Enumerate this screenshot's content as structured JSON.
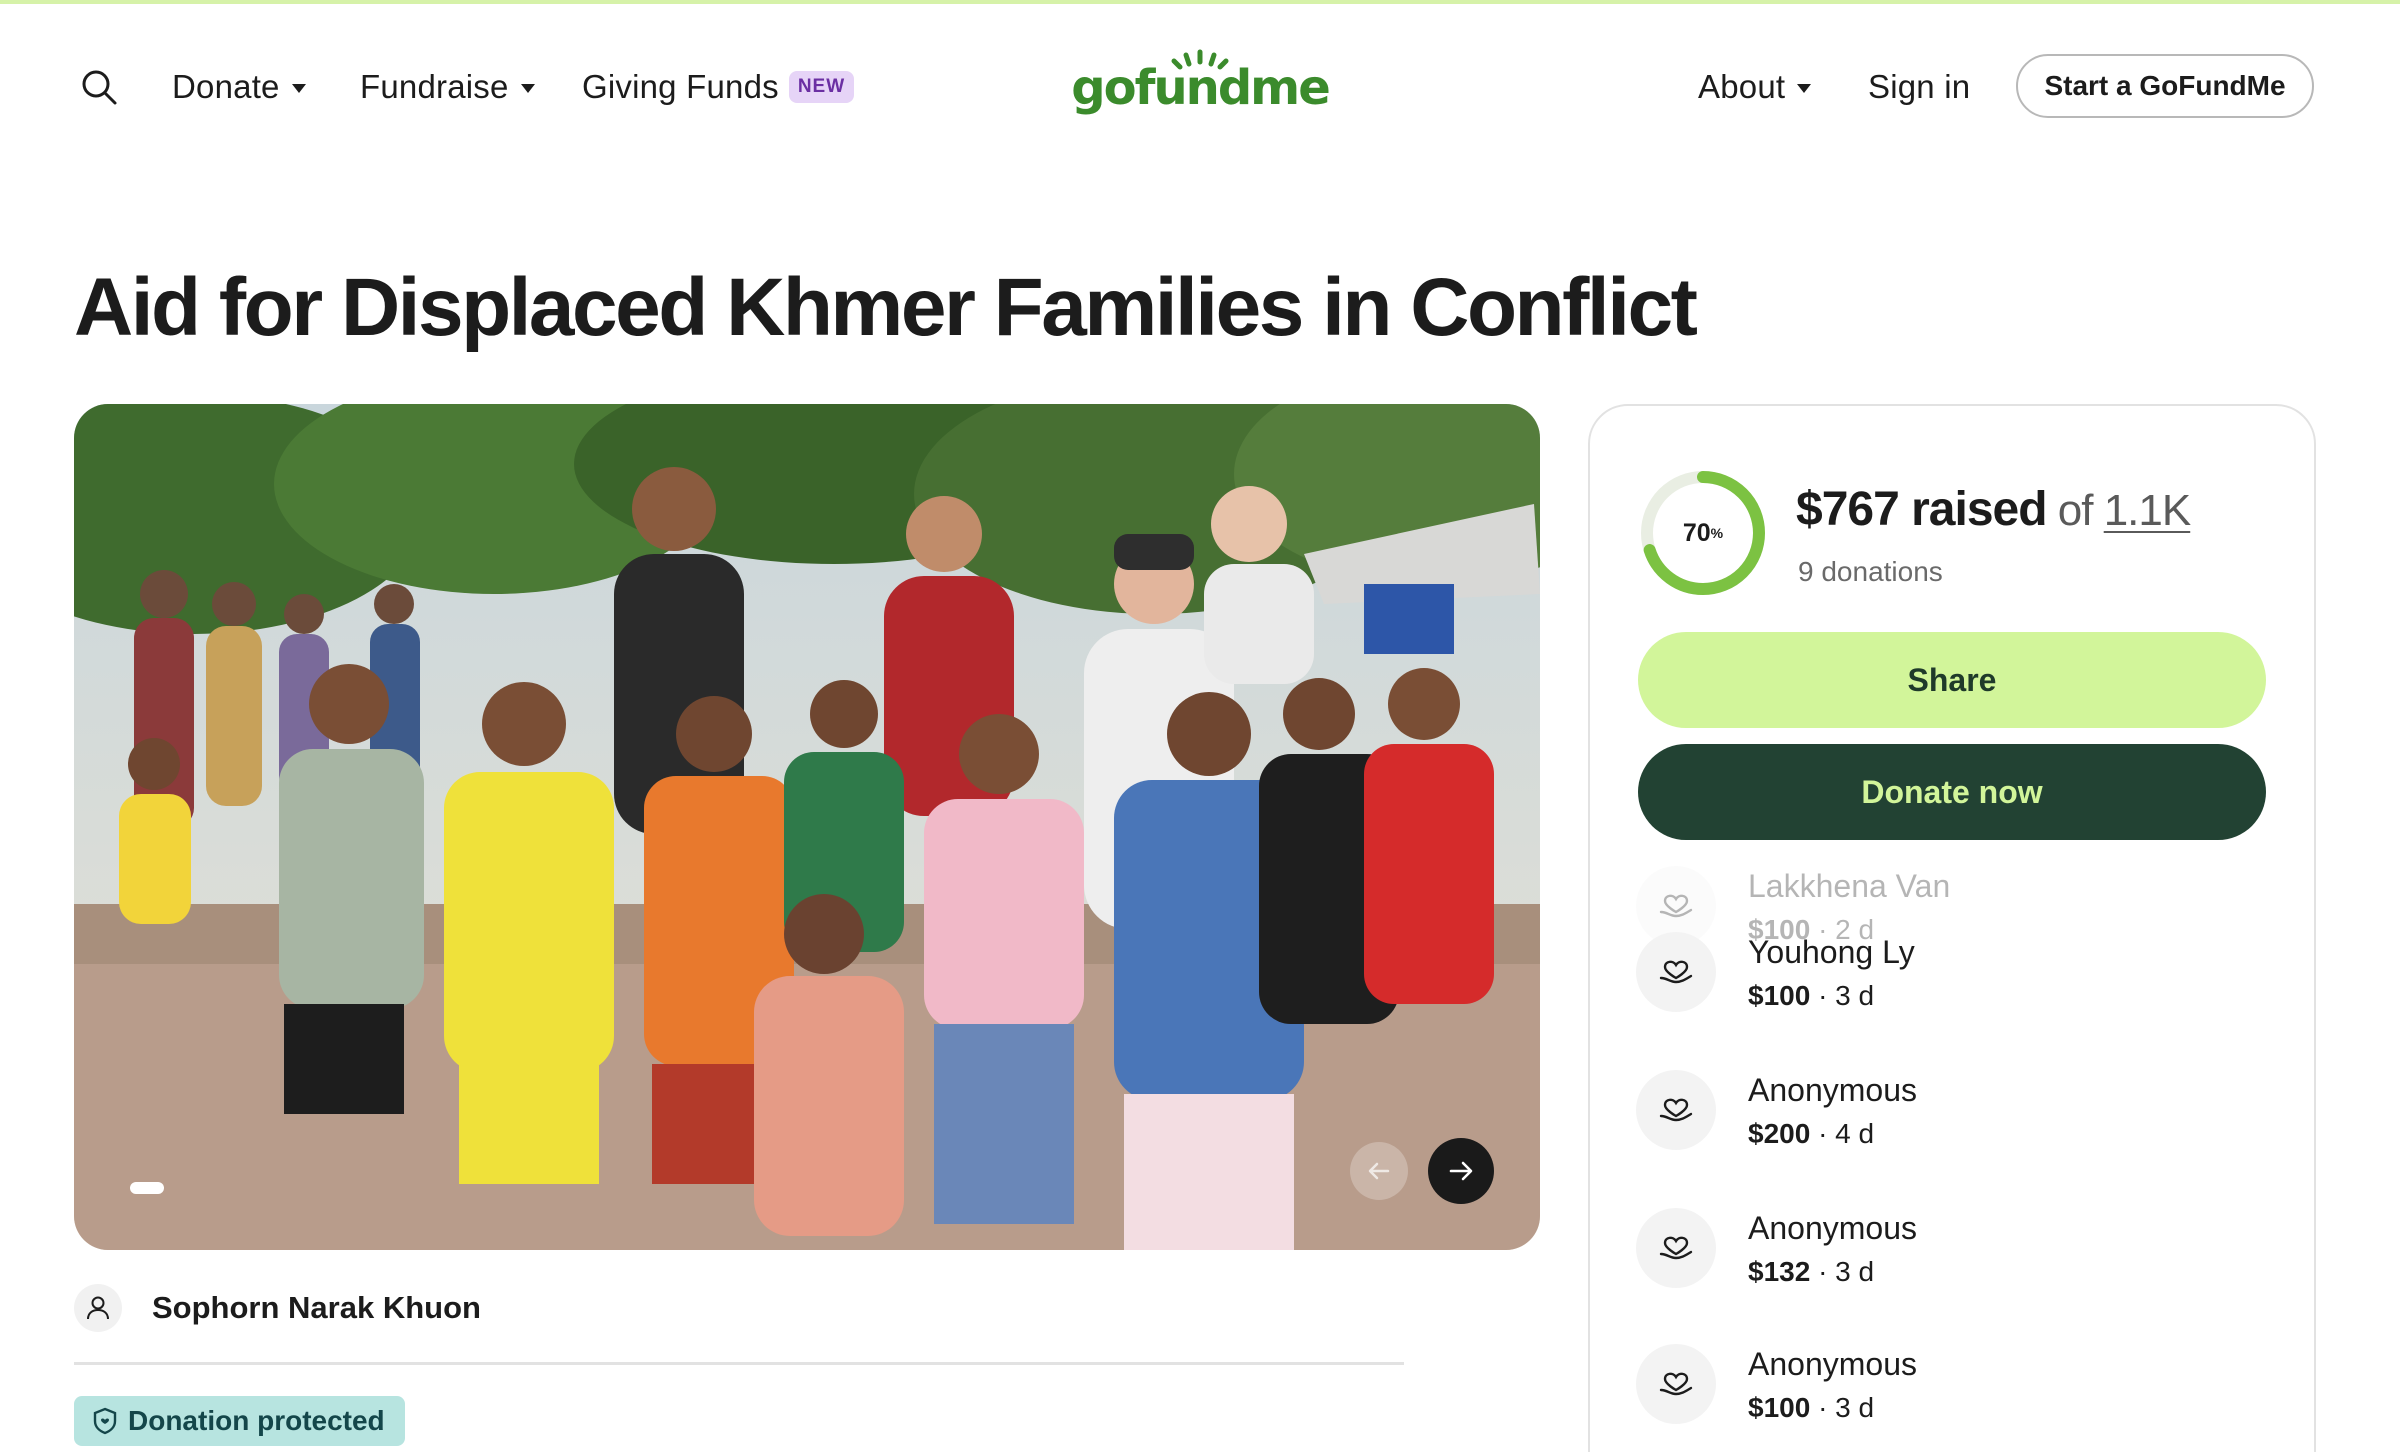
{
  "header": {
    "nav": {
      "donate": "Donate",
      "fundraise": "Fundraise",
      "giving_funds": "Giving Funds",
      "new_badge": "NEW",
      "about": "About",
      "sign_in": "Sign in"
    },
    "logo_text": "gofundme",
    "start_button": "Start a GoFundMe"
  },
  "campaign": {
    "title": "Aid for Displaced Khmer Families in Conflict",
    "organizer": "Sophorn Narak Khuon",
    "protected_label": "Donation protected"
  },
  "progress": {
    "percent_label": "70",
    "percent_sign": "%",
    "fraction": 0.7,
    "raised": "$767 raised",
    "of": " of ",
    "goal": "1.1K",
    "donations": "9 donations"
  },
  "buttons": {
    "share": "Share",
    "donate_now": "Donate now"
  },
  "donors": [
    {
      "name": "Lakkhena Van",
      "amount": "$100",
      "time": " · 2 d"
    },
    {
      "name": "Youhong Ly",
      "amount": "$100",
      "time": " · 3 d"
    },
    {
      "name": "Anonymous",
      "amount": "$200",
      "time": " · 4 d"
    },
    {
      "name": "Anonymous",
      "amount": "$132",
      "time": " · 3 d"
    },
    {
      "name": "Anonymous",
      "amount": "$100",
      "time": " · 3 d"
    }
  ],
  "colors": {
    "brand_green": "#3b8b2c",
    "share_bg": "#d2f59a",
    "donate_bg": "#224233",
    "progress": "#7cc242",
    "protected_bg": "#b7e4e0"
  },
  "icons": [
    "search-icon",
    "caret-down-icon",
    "arrow-left-icon",
    "arrow-right-icon",
    "user-icon",
    "shield-icon",
    "heart-hand-icon"
  ]
}
